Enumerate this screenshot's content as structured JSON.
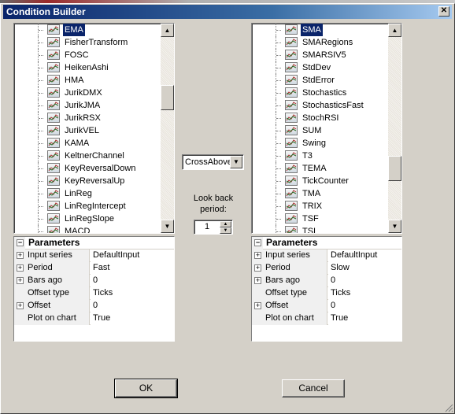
{
  "window": {
    "title": "Condition Builder"
  },
  "left_list": {
    "items": [
      "EMA",
      "FisherTransform",
      "FOSC",
      "HeikenAshi",
      "HMA",
      "JurikDMX",
      "JurikJMA",
      "JurikRSX",
      "JurikVEL",
      "KAMA",
      "KeltnerChannel",
      "KeyReversalDown",
      "KeyReversalUp",
      "LinReg",
      "LinRegIntercept",
      "LinRegSlope",
      "MACD"
    ],
    "selected": "EMA"
  },
  "right_list": {
    "items": [
      "SMA",
      "SMARegions",
      "SMARSIV5",
      "StdDev",
      "StdError",
      "Stochastics",
      "StochasticsFast",
      "StochRSI",
      "SUM",
      "Swing",
      "T3",
      "TEMA",
      "TickCounter",
      "TMA",
      "TRIX",
      "TSF",
      "TSI"
    ],
    "selected": "SMA"
  },
  "left_params": {
    "header": "Parameters",
    "rows": [
      {
        "name": "Input series",
        "value": "DefaultInput",
        "expandable": true
      },
      {
        "name": "Period",
        "value": "Fast",
        "expandable": true
      },
      {
        "name": "Bars ago",
        "value": "0",
        "expandable": true
      },
      {
        "name": "Offset type",
        "value": "Ticks",
        "expandable": false
      },
      {
        "name": "Offset",
        "value": "0",
        "expandable": true
      },
      {
        "name": "Plot on chart",
        "value": "True",
        "expandable": false
      }
    ]
  },
  "right_params": {
    "header": "Parameters",
    "rows": [
      {
        "name": "Input series",
        "value": "DefaultInput",
        "expandable": true
      },
      {
        "name": "Period",
        "value": "Slow",
        "expandable": true
      },
      {
        "name": "Bars ago",
        "value": "0",
        "expandable": true
      },
      {
        "name": "Offset type",
        "value": "Ticks",
        "expandable": false
      },
      {
        "name": "Offset",
        "value": "0",
        "expandable": true
      },
      {
        "name": "Plot on chart",
        "value": "True",
        "expandable": false
      }
    ]
  },
  "operator": {
    "value": "CrossAbove"
  },
  "lookback": {
    "label": "Look back period:",
    "value": "1"
  },
  "buttons": {
    "ok": "OK",
    "cancel": "Cancel"
  },
  "icons": {
    "close": "close-icon",
    "indicator": "indicator-chart-icon",
    "scroll_up": "scroll-up-arrow-icon",
    "scroll_down": "scroll-down-arrow-icon",
    "dropdown": "chevron-down-icon",
    "expand": "plus-icon",
    "collapse": "minus-icon"
  },
  "colors": {
    "title_start": "#0a246a",
    "title_end": "#a6caf0",
    "selection": "#0a246a",
    "face": "#d4d0c8"
  }
}
